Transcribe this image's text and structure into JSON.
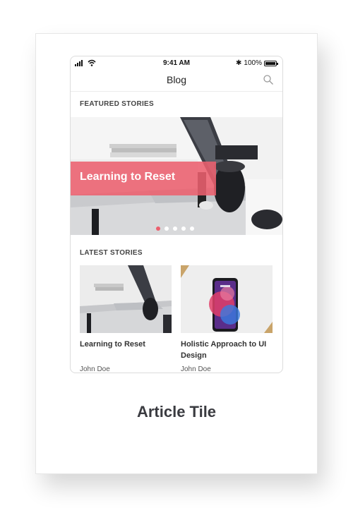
{
  "status_bar": {
    "time": "9:41 AM",
    "battery_percent": "100%",
    "bluetooth_symbol": "✱"
  },
  "navbar": {
    "title": "Blog",
    "search_icon": "search-icon"
  },
  "featured": {
    "section_label": "FEATURED STORIES",
    "slide_title": "Learning to Reset",
    "slide_count": 5,
    "active_slide": 1
  },
  "latest": {
    "section_label": "LATEST STORIES",
    "items": [
      {
        "title": "Learning to Reset",
        "author": "John Doe"
      },
      {
        "title": "Holistic Approach to UI Design",
        "author": "John Doe"
      }
    ]
  },
  "caption": "Article Tile",
  "colors": {
    "accent": "#ec5f6d",
    "caption_text": "#3a3b40"
  }
}
